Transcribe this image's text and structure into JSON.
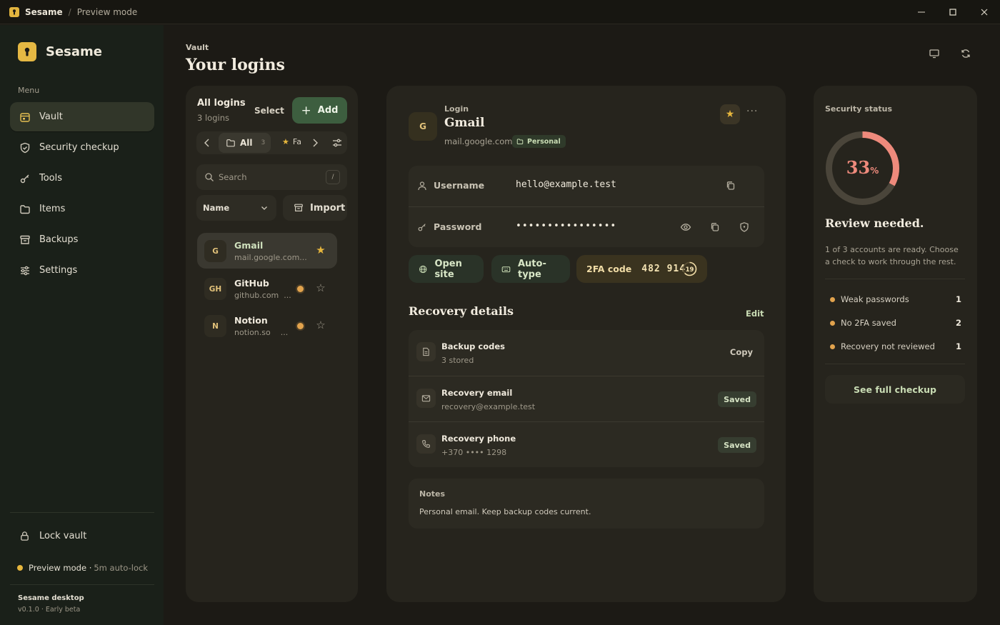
{
  "titlebar": {
    "app": "Sesame",
    "separator": "/",
    "mode": "Preview mode"
  },
  "sidebar": {
    "brand": "Sesame",
    "menu_label": "Menu",
    "items": [
      {
        "label": "Vault",
        "icon": "calendar-icon",
        "active": true
      },
      {
        "label": "Security checkup",
        "icon": "shield-icon",
        "active": false
      },
      {
        "label": "Tools",
        "icon": "key-icon",
        "active": false
      },
      {
        "label": "Items",
        "icon": "folder-icon",
        "active": false
      },
      {
        "label": "Backups",
        "icon": "archive-icon",
        "active": false
      },
      {
        "label": "Settings",
        "icon": "sliders-icon",
        "active": false
      }
    ],
    "lock_label": "Lock vault",
    "preview_label": "Preview mode ·",
    "preview_sub": "5m auto-lock",
    "version_title": "Sesame desktop",
    "version_sub": "v0.1.0 · Early beta"
  },
  "header": {
    "breadcrumb": "Vault",
    "title": "Your logins"
  },
  "list": {
    "title": "All logins",
    "count": "3 logins",
    "select_label": "Select",
    "add_label": "Add",
    "filter_all": "All",
    "filter_all_count": "3",
    "filter_fav": "Fa",
    "search_placeholder": "Search",
    "search_shortcut": "/",
    "sort_label": "Name",
    "import_label": "Import",
    "rows": [
      {
        "initials": "G",
        "name": "Gmail",
        "url": "mail.google.com...",
        "favorite": true,
        "selected": true,
        "flag": false
      },
      {
        "initials": "GH",
        "name": "GitHub",
        "url": "github.com",
        "favorite": false,
        "selected": false,
        "flag": true
      },
      {
        "initials": "N",
        "name": "Notion",
        "url": "notion.so",
        "favorite": false,
        "selected": false,
        "flag": true
      }
    ]
  },
  "detail": {
    "initials": "G",
    "type": "Login",
    "name": "Gmail",
    "url": "mail.google.com",
    "tag": "Personal",
    "username_label": "Username",
    "username_value": "hello@example.test",
    "password_label": "Password",
    "password_value": "••••••••••••••••",
    "open_site_label": "Open site",
    "autotype_label": "Auto-type",
    "totp_label": "2FA code",
    "totp_code": "482 914",
    "totp_seconds": "19",
    "recovery_title": "Recovery details",
    "edit_label": "Edit",
    "recovery": [
      {
        "title": "Backup codes",
        "sub": "3 stored",
        "action": "Copy",
        "icon": "file-icon"
      },
      {
        "title": "Recovery email",
        "sub": "recovery@example.test",
        "action": "Saved",
        "icon": "mail-icon"
      },
      {
        "title": "Recovery phone",
        "sub": "+370 •••• 1298",
        "action": "Saved",
        "icon": "phone-icon"
      }
    ],
    "notes_title": "Notes",
    "notes_text": "Personal email. Keep backup codes current."
  },
  "security": {
    "label": "Security status",
    "score": "33",
    "score_unit": "%",
    "score_fraction": 0.33,
    "headline": "Review needed.",
    "description": "1 of 3 accounts are ready. Choose a check to work through the rest.",
    "issues": [
      {
        "label": "Weak passwords",
        "count": "1"
      },
      {
        "label": "No 2FA saved",
        "count": "2"
      },
      {
        "label": "Recovery not reviewed",
        "count": "1"
      }
    ],
    "button_label": "See full checkup"
  },
  "colors": {
    "accent_green": "#3d5e3f",
    "accent_gold": "#e6b63d",
    "warning": "#e2a34d",
    "score": "#ee8a7c"
  }
}
